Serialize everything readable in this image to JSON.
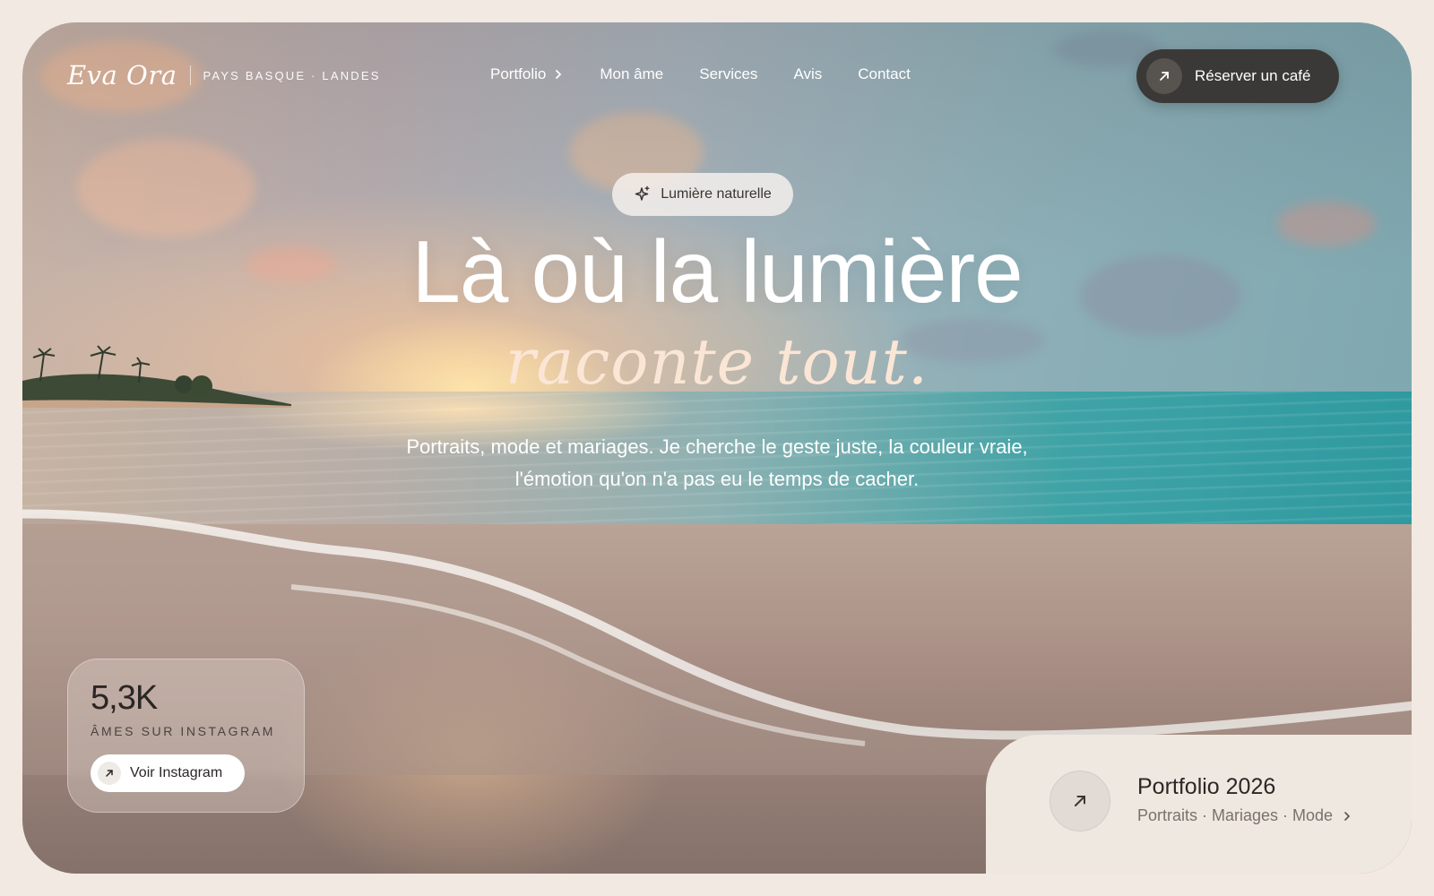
{
  "brand": {
    "name": "Eva Ora",
    "tagline": "PAYS BASQUE · LANDES"
  },
  "nav": {
    "items": [
      {
        "label": "Portfolio",
        "icon": "chevron-right-icon"
      },
      {
        "label": "Mon âme"
      },
      {
        "label": "Services"
      },
      {
        "label": "Avis"
      },
      {
        "label": "Contact"
      }
    ]
  },
  "cta": {
    "label": "Réserver un café",
    "icon": "arrow-up-right-icon"
  },
  "hero": {
    "badge": {
      "label": "Lumière naturelle",
      "icon": "sparkle-icon"
    },
    "title": "Là où la lumière",
    "title_italic": "raconte tout.",
    "subtitle_line1": "Portraits, mode et mariages. Je cherche le geste juste, la couleur vraie,",
    "subtitle_line2": "l'émotion qu'on n'a pas eu le temps de cacher."
  },
  "instagram": {
    "count": "5,3K",
    "label": "ÂMES SUR INSTAGRAM",
    "button_label": "Voir Instagram",
    "button_icon": "arrow-up-right-icon"
  },
  "portfolio_card": {
    "title": "Portfolio 2026",
    "subtitle": "Portraits · Mariages · Mode",
    "icon": "arrow-up-right-icon",
    "chevron": "chevron-right-icon"
  },
  "colors": {
    "page_bg": "#f1e9e2",
    "cta_bg": "#3b3937",
    "accent_italic": "#fbe6d6",
    "card_bg": "#efe8e1"
  }
}
